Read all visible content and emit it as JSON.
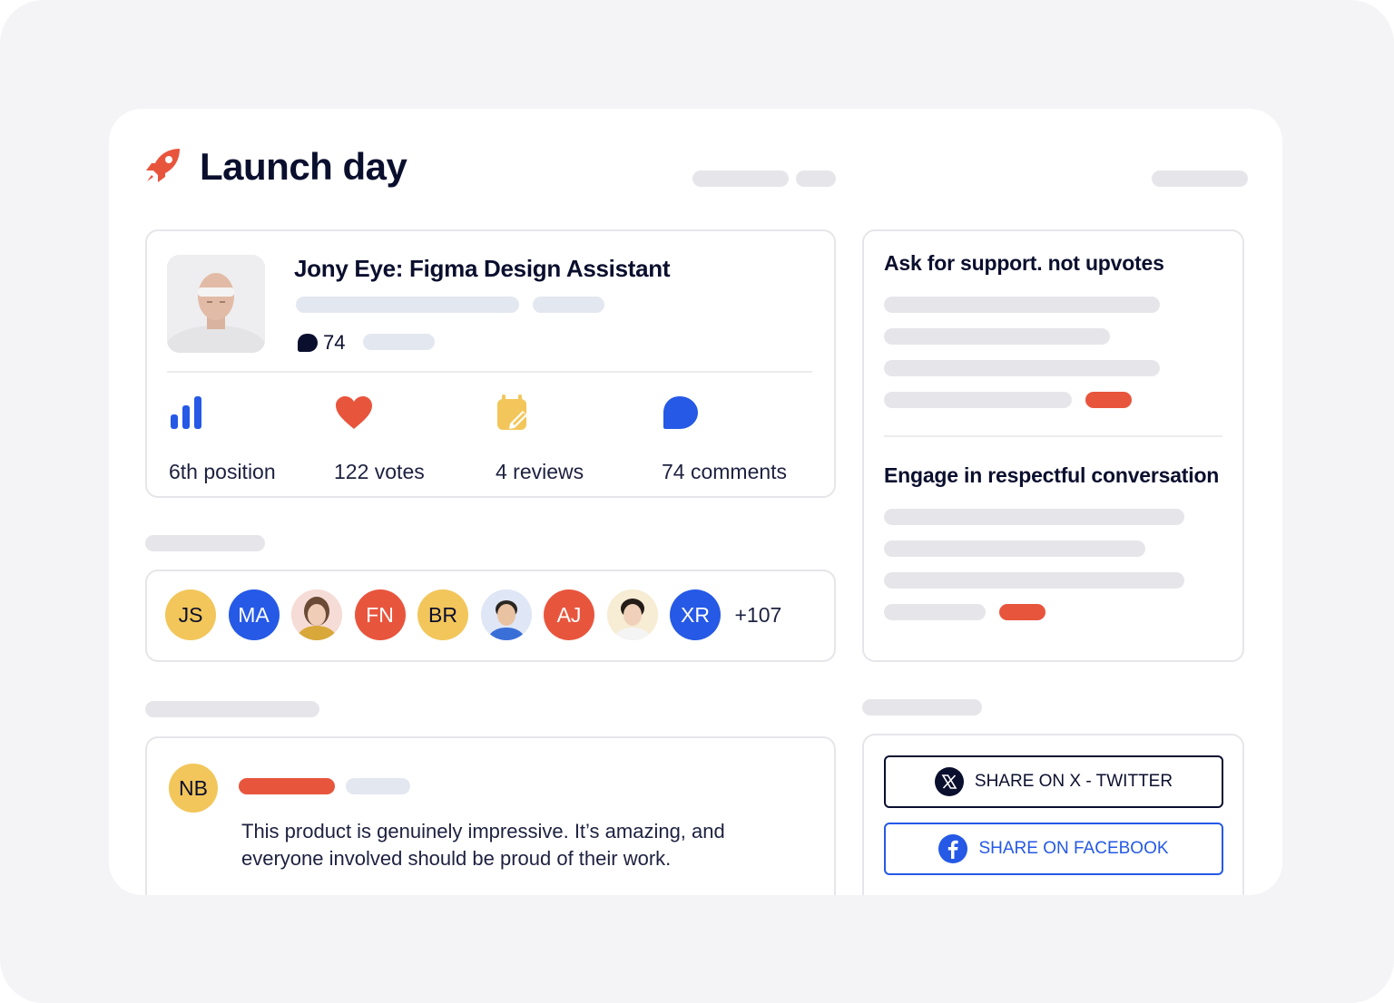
{
  "header": {
    "title": "Launch day",
    "icon": "rocket-icon",
    "accent": "#e8553d"
  },
  "product": {
    "title": "Jony Eye: Figma Design Assistant",
    "comment_count": "74",
    "stats": [
      {
        "label": "6th position",
        "icon": "bar-chart-icon"
      },
      {
        "label": "122 votes",
        "icon": "heart-icon"
      },
      {
        "label": "4 reviews",
        "icon": "calendar-edit-icon"
      },
      {
        "label": "74 comments",
        "icon": "chat-bubble-icon"
      }
    ]
  },
  "supporters": {
    "avatars": [
      {
        "initials": "JS",
        "color": "yellow"
      },
      {
        "initials": "MA",
        "color": "blue"
      },
      {
        "initials": "",
        "color": "photo"
      },
      {
        "initials": "FN",
        "color": "red"
      },
      {
        "initials": "BR",
        "color": "yellow"
      },
      {
        "initials": "",
        "color": "photo"
      },
      {
        "initials": "AJ",
        "color": "red"
      },
      {
        "initials": "",
        "color": "photo"
      },
      {
        "initials": "XR",
        "color": "blue"
      }
    ],
    "more": "+107"
  },
  "review": {
    "initials": "NB",
    "text": "This product is genuinely impressive. It’s amazing, and everyone involved should be proud of their work."
  },
  "tips": {
    "first": "Ask for support. not upvotes",
    "second": "Engage in respectful conversation"
  },
  "share": {
    "x_label": "SHARE ON X - TWITTER",
    "facebook_label": "SHARE ON FACEBOOK"
  },
  "colors": {
    "blue": "#2559e6",
    "red": "#e8553d",
    "yellow": "#f2c65a",
    "dark": "#0b0f2e"
  }
}
